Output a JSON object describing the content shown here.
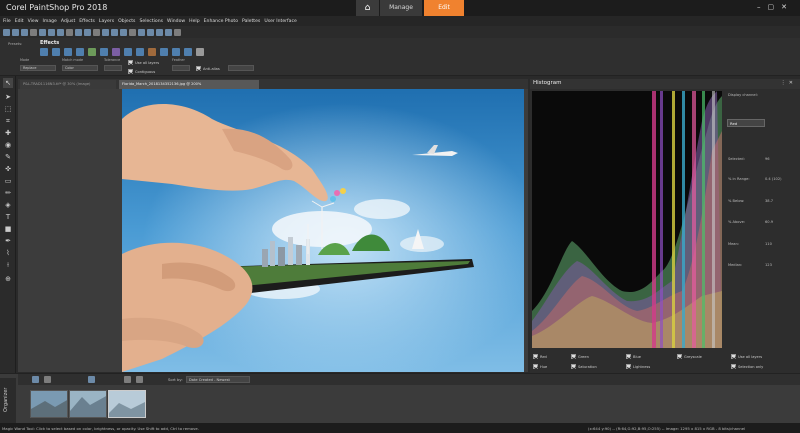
{
  "app": {
    "title": "Corel PaintShop Pro 2018"
  },
  "workspace_tabs": {
    "manage": "Manage",
    "edit": "Edit"
  },
  "menu": [
    "File",
    "Edit",
    "View",
    "Image",
    "Adjust",
    "Effects",
    "Layers",
    "Objects",
    "Selections",
    "Window",
    "Help",
    "Enhance Photo",
    "Palettes",
    "User Interface"
  ],
  "presets": {
    "effects_label": "Effects",
    "presets_label": "Presets:",
    "mode_label": "Mode",
    "mode_value": "Replace",
    "match_mode_label": "Match mode",
    "match_mode_value": "Color",
    "tolerance_label": "Tolerance",
    "feather_label": "Feather",
    "use_all_layers": "Use all layers",
    "contiguous": "Contiguous",
    "antialias": "Anti-alias"
  },
  "documents": {
    "tab1": "P&L-TRAD1116N3.tif* @ 30% (Image)",
    "tab2": "Florida_March_2018134352136.jpg @ 200%"
  },
  "histogram": {
    "title": "Histogram",
    "display_channel_label": "Display channel:",
    "channel_value": "Red",
    "stats": [
      {
        "label": "Selected:",
        "value": "96"
      },
      {
        "label": "% in Range:",
        "value": "0.4 (102)"
      },
      {
        "label": "% Below:",
        "value": "38.7"
      },
      {
        "label": "% Above:",
        "value": "60.9"
      },
      {
        "label": "Mean:",
        "value": "110"
      },
      {
        "label": "Median:",
        "value": "123"
      }
    ],
    "checkboxes": {
      "red": "Red",
      "green": "Green",
      "blue": "Blue",
      "greyscale": "Greyscale",
      "hue": "Hue",
      "saturation": "Saturation",
      "lightness": "Lightness",
      "use_all_layers": "Use all layers",
      "selection_only": "Selection only"
    }
  },
  "organizer": {
    "label": "Organizer",
    "sort_label": "Sort by:",
    "sort_value": "Date Created - Newest"
  },
  "status": {
    "left": "Magic Wand Tool: Click to select based on color, brightness, or opacity. Use Shift to add, Ctrl to remove.",
    "right": "(x:644 y:90) -- (R:64,G:92,B:95,O:255) -- Image: 1295 x 815 x RGB - 8 bits/channel"
  },
  "colors": {
    "accent": "#f0822f",
    "sky": "#3f8fc7"
  }
}
